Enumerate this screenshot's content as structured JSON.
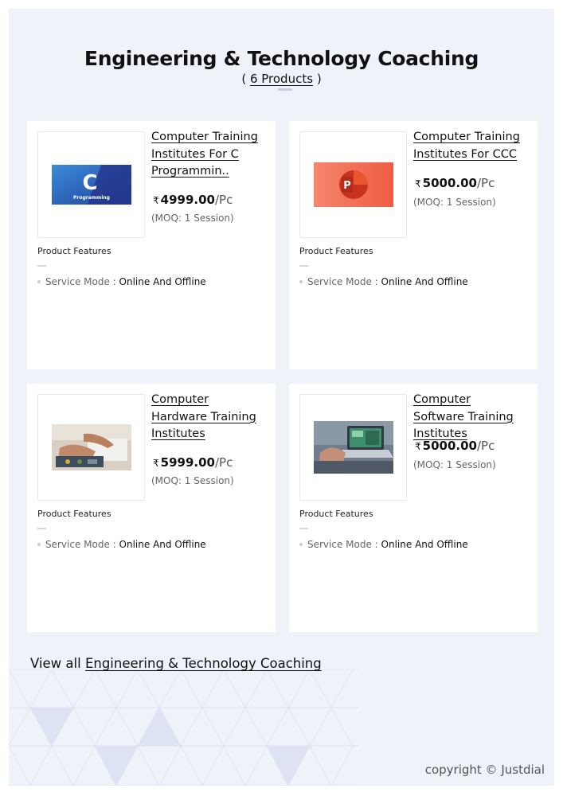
{
  "header": {
    "title": "Engineering & Technology Coaching",
    "subtitle_open": "( ",
    "subtitle_count": "6 Products",
    "subtitle_close": " )"
  },
  "products": [
    {
      "name": "Computer Training Institutes For C Programmin..",
      "currency": "₹",
      "price": "4999.00",
      "unit": "/Pc",
      "moq": "(MOQ: 1 Session)",
      "features_label": "Product Features",
      "feature_key": "Service Mode :",
      "feature_value": "Online And Offline",
      "image_text": "Programming",
      "image_letter": "C"
    },
    {
      "name": "Computer Training Institutes For CCC",
      "currency": "₹",
      "price": "5000.00",
      "unit": "/Pc",
      "moq": "(MOQ: 1 Session)",
      "features_label": "Product Features",
      "feature_key": "Service Mode :",
      "feature_value": "Online And Offline",
      "image_letter": "P"
    },
    {
      "name": "Computer Hardware Training Institutes",
      "currency": "₹",
      "price": "5999.00",
      "unit": "/Pc",
      "moq": "(MOQ: 1 Session)",
      "features_label": "Product Features",
      "feature_key": "Service Mode :",
      "feature_value": "Online And Offline"
    },
    {
      "name": "Computer Software Training Institutes",
      "currency": "₹",
      "price": "5000.00",
      "unit": "/Pc",
      "moq": "(MOQ: 1 Session)",
      "features_label": "Product Features",
      "feature_key": "Service Mode :",
      "feature_value": "Online And Offline"
    }
  ],
  "footer": {
    "view_all_prefix": "View all ",
    "view_all_link": "Engineering & Technology Coaching",
    "copyright": "copyright © Justdial"
  },
  "colors": {
    "page_bg": "#eff2f9",
    "card_bg": "#ffffff",
    "c_logo_blue": "#2d62b5",
    "ppt_orange": "#f26a4f"
  }
}
